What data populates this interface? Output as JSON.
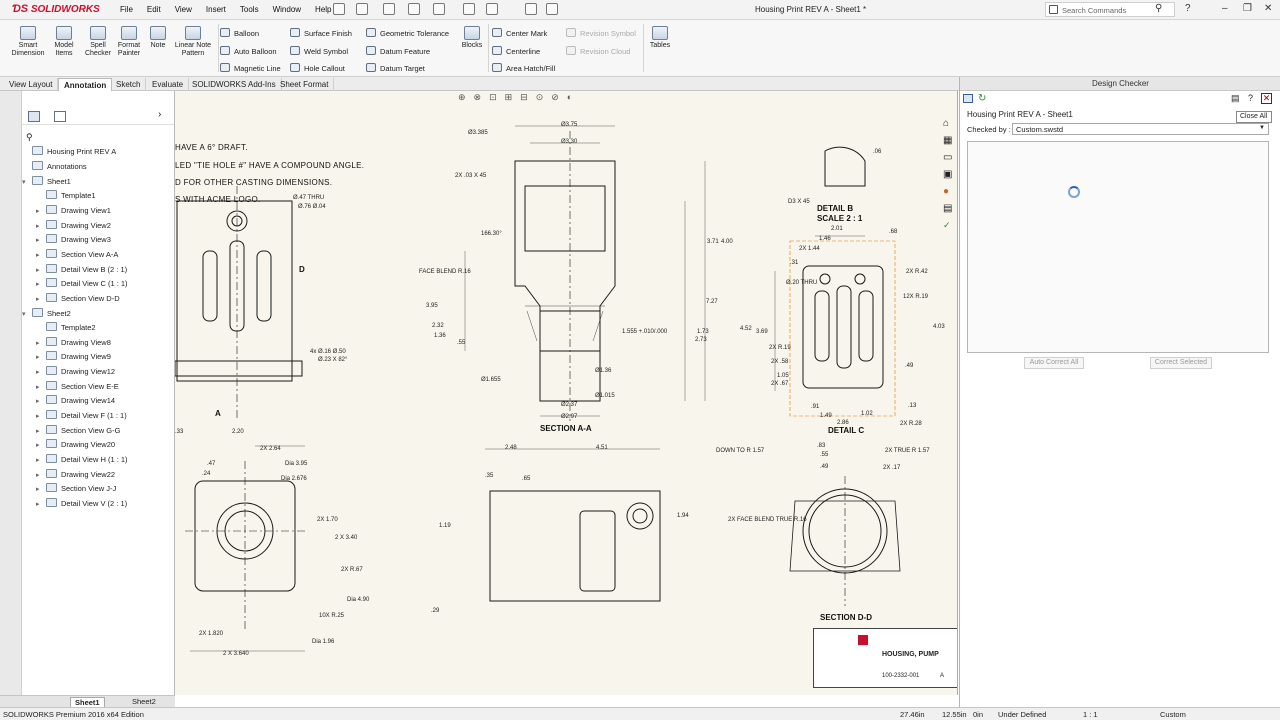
{
  "app": {
    "name": "SOLIDWORKS",
    "document_title": "Housing Print REV A - Sheet1 *"
  },
  "menu": [
    "File",
    "Edit",
    "View",
    "Insert",
    "Tools",
    "Window",
    "Help"
  ],
  "search": {
    "placeholder": "Search Commands"
  },
  "ribbon": {
    "big_buttons": [
      "Smart Dimension",
      "Model Items",
      "Spell Checker",
      "Format Painter",
      "Note",
      "Linear Note Pattern"
    ],
    "col1": [
      "Balloon",
      "Auto Balloon",
      "Magnetic Line"
    ],
    "col2": [
      "Surface Finish",
      "Weld Symbol",
      "Hole Callout"
    ],
    "col3": [
      "Geometric Tolerance",
      "Datum Feature",
      "Datum Target"
    ],
    "blocks": "Blocks",
    "col4": [
      "Center Mark",
      "Centerline",
      "Area Hatch/Fill"
    ],
    "col5": [
      "Revision Symbol",
      "Revision Cloud"
    ],
    "tables": "Tables"
  },
  "tabs": [
    "View Layout",
    "Annotation",
    "Sketch",
    "Evaluate",
    "SOLIDWORKS Add-Ins",
    "Sheet Format"
  ],
  "active_tab": "Annotation",
  "tree": {
    "root": "Housing Print REV A",
    "items": [
      "Annotations",
      "Sheet1",
      "Template1",
      "Drawing View1",
      "Drawing View2",
      "Drawing View3",
      "Section View A-A",
      "Detail View B (2 : 1)",
      "Detail View C (1 : 1)",
      "Section View D-D",
      "Sheet2",
      "Template2",
      "Drawing View8",
      "Drawing View9",
      "Drawing View12",
      "Section View E-E",
      "Drawing View14",
      "Detail View F (1 : 1)",
      "Section View G-G",
      "Drawing View20",
      "Detail View H (1 : 1)",
      "Drawing View22",
      "Section View J-J",
      "Detail View V (2 : 1)"
    ]
  },
  "sheet_tabs": [
    "Sheet1",
    "Sheet2"
  ],
  "drawing": {
    "notes": [
      "HAVE A 6° DRAFT.",
      "LED \"TIE HOLE #\" HAVE A COMPOUND ANGLE.",
      "D FOR OTHER CASTING DIMENSIONS.",
      "S WITH ACME LOGO."
    ],
    "labels": {
      "section_aa": "SECTION A-A",
      "detail_b": "DETAIL B",
      "scale_b": "SCALE 2 : 1",
      "detail_c": "DETAIL C",
      "section_dd": "SECTION D-D",
      "A": "A",
      "D": "D",
      "title_block": "HOUSING, PUMP",
      "part_no": "100-2332-001",
      "rev": "A"
    },
    "dims": [
      "Ø3.385",
      "Ø3.75",
      "Ø3.30",
      "2X .03 X 45",
      "166.30°",
      "FACE BLEND R.16",
      "3.95",
      "2.32",
      "1.36",
      ".55",
      "Ø1.655",
      "Ø2.37",
      "Ø2.97",
      "Ø1.36",
      "Ø1.015",
      "1.555 +.010/.000",
      "1.73",
      "2.73",
      "3.71",
      "4.00",
      "7.27",
      ".06",
      "D3 X 45",
      "2.01",
      "1.46",
      "2X 1.44",
      ".31",
      "Ø.20 THRU",
      "2X R.42",
      "12X R.19",
      "4.52",
      "3.69",
      "2X R.19",
      "2X .58",
      "2X .67",
      "1.05",
      ".91",
      "1.49",
      "1.02",
      "2X R.28",
      "2.86",
      "4.03",
      ".49",
      ".13",
      ".68",
      "4x Ø.16 Ø.50",
      "Ø.23 X 82°",
      "Ø.47 THRU",
      "Ø.76 Ø.04",
      "2X 2.64",
      "Dia 3.95",
      "Dia 2.676",
      ".47",
      ".24",
      "2X 1.70",
      "2 X 3.40",
      "2X R.67",
      "Dia 4.90",
      "10X R.25",
      "Dia 1.96",
      "2X 1.820",
      "2 X 3.640",
      "2.48",
      "4.51",
      ".35",
      ".65",
      "1.19",
      "1.94",
      ".29",
      ".83",
      ".55",
      ".49",
      "DOWN TO R 1.57",
      "2X TRUE R 1.57",
      "2X .17",
      "2X FACE BLEND TRUE R.16",
      ".33",
      "2.20"
    ]
  },
  "design_checker": {
    "title": "Design Checker",
    "doc": "Housing Print REV A - Sheet1",
    "checked_by_label": "Checked by :",
    "checked_by_value": "Custom.swstd",
    "tooltip": "Close All",
    "auto_correct": "Auto Correct All",
    "correct_selected": "Correct Selected"
  },
  "status": {
    "edition": "SOLIDWORKS Premium 2016 x64 Edition",
    "x": "27.46in",
    "y": "12.55in",
    "z": "0in",
    "state": "Under Defined",
    "scale": "1 : 1",
    "units": "Custom"
  },
  "colors": {
    "brand": "#c8102e",
    "canvas": "#f7f5ec",
    "accent": "#2f63a8"
  }
}
